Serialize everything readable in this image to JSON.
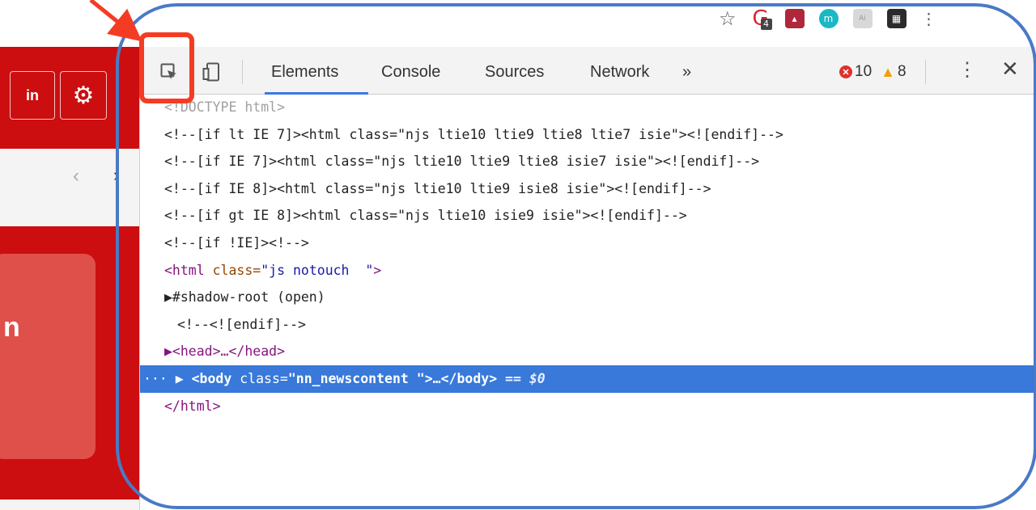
{
  "browser_toolbar": {
    "extension_badge": "4",
    "ext3_label": "m",
    "ext4_label": "Ai"
  },
  "page": {
    "signin_label": "in",
    "card_letter": "n",
    "nav_prev": "‹",
    "nav_next": "›"
  },
  "devtools": {
    "tabs": [
      "Elements",
      "Console",
      "Sources",
      "Network"
    ],
    "more_tabs": "»",
    "error_count": "10",
    "warning_count": "8",
    "menu": "⋮",
    "close": "✕",
    "tree": [
      "<!DOCTYPE html>",
      "<!--[if lt IE 7]><html class=\"njs ltie10 ltie9 ltie8 ltie7 isie\"><![endif]-->",
      "<!--[if IE 7]><html class=\"njs ltie10 ltie9 ltie8 isie7 isie\"><![endif]-->",
      "<!--[if IE 8]><html class=\"njs ltie10 ltie9 isie8 isie\"><![endif]-->",
      "<!--[if gt IE 8]><html class=\"njs ltie10 isie9 isie\"><![endif]-->",
      "<!--[if !IE]><!-->"
    ],
    "html_open": {
      "tag": "<html",
      "attr": " class=",
      "val": "\"js notouch  \"",
      "end": ">"
    },
    "shadow_root": "▶#shadow-root (open)",
    "endif_comment": "<!--<![endif]-->",
    "head_node": "▶<head>…</head>",
    "body_node": {
      "prefix": "··· ▶ ",
      "tag": "<body",
      "attr": " class=",
      "val": "\"nn_newscontent \"",
      "rest": ">…</body>",
      "marker": " == $0"
    },
    "html_close": "</html>"
  },
  "colors": {
    "brand_red": "#cc0e10",
    "selected_row": "#3879d9",
    "annotation_blue": "#4a7ac6",
    "annotation_red": "#f43c25"
  }
}
